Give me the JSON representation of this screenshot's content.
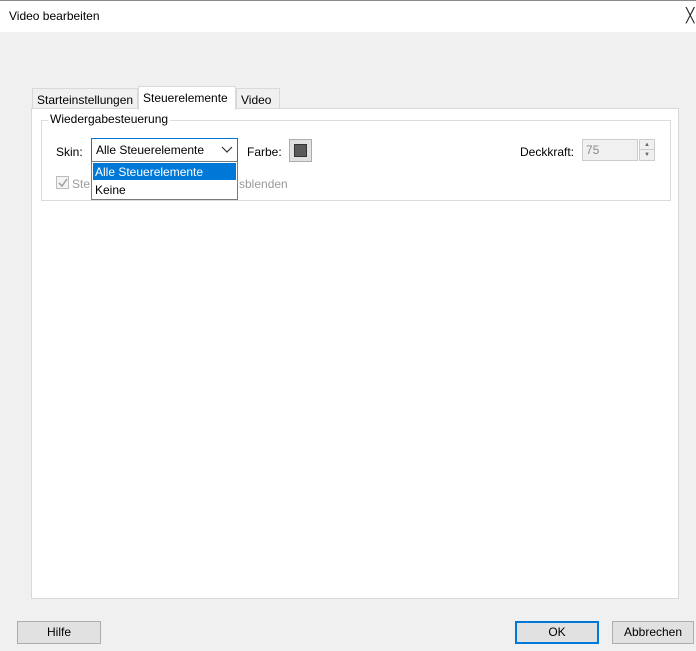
{
  "window": {
    "title": "Video bearbeiten",
    "close_glyph": "╳"
  },
  "tabs": [
    {
      "label": "Starteinstellungen",
      "active": false
    },
    {
      "label": "Steuerelemente",
      "active": true
    },
    {
      "label": "Video",
      "active": false
    }
  ],
  "group": {
    "title": "Wiedergabesteuerung"
  },
  "skin": {
    "label": "Skin:",
    "value": "Alle Steuerelemente",
    "options": [
      "Alle Steuerelemente",
      "Keine"
    ],
    "selected_index": 0
  },
  "farbe": {
    "label": "Farbe:",
    "color": "#5a5a5a"
  },
  "deckkraft": {
    "label": "Deckkraft:",
    "value": "75"
  },
  "checkbox": {
    "label_left": "Ste",
    "label_right": "sblenden",
    "checked": true
  },
  "buttons": {
    "help": "Hilfe",
    "ok": "OK",
    "cancel": "Abbrechen"
  }
}
